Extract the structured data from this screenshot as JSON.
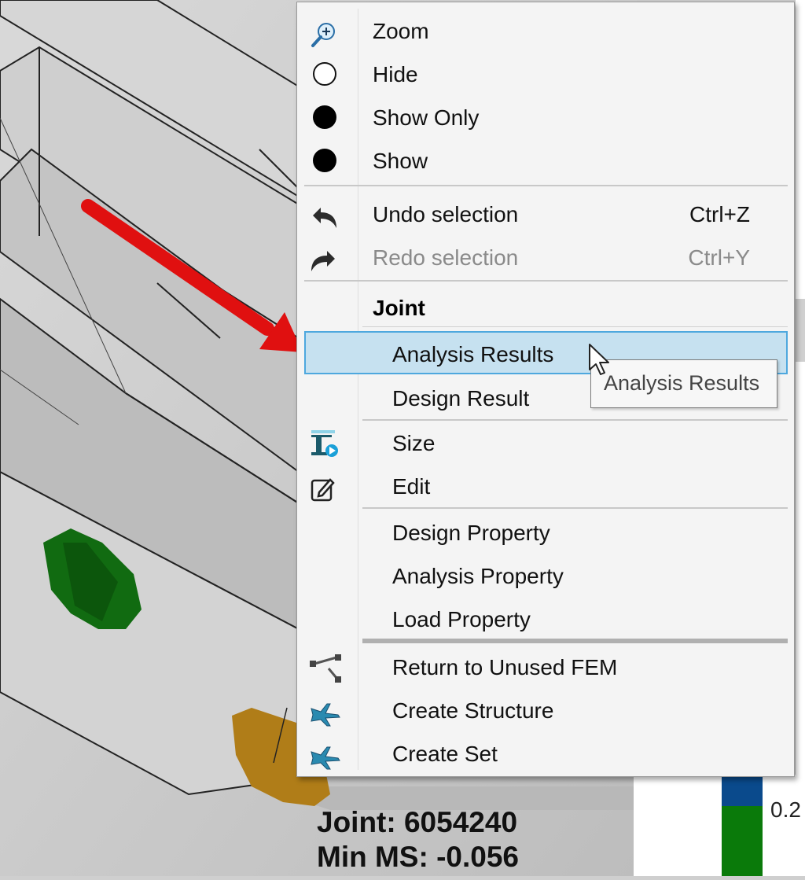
{
  "context_menu": {
    "zoom": "Zoom",
    "hide": "Hide",
    "show_only": "Show Only",
    "show": "Show",
    "undo": {
      "label": "Undo selection",
      "shortcut": "Ctrl+Z"
    },
    "redo": {
      "label": "Redo selection",
      "shortcut": "Ctrl+Y",
      "disabled": true
    },
    "section_header": "Joint",
    "analysis_results": "Analysis Results",
    "design_result": "Design Result",
    "size": "Size",
    "edit": "Edit",
    "design_property": "Design Property",
    "analysis_property": "Analysis Property",
    "load_property": "Load Property",
    "return_unused_fem": "Return to Unused FEM",
    "create_structure": "Create Structure",
    "create_set": "Create Set",
    "highlight_color": "#c6e1f0",
    "highlight_border": "#4ea8de"
  },
  "tooltip": "Analysis Results",
  "joint_info": {
    "joint": "Joint: 6054240",
    "min_ms": "Min MS: -0.056"
  },
  "legend": {
    "value": "0.2",
    "colors": [
      "#0a4a8c",
      "#0a7a0a"
    ]
  },
  "annotation_arrow_color": "#e01010",
  "icons": [
    "zoom-icon",
    "hide-icon",
    "show-only-icon",
    "show-icon",
    "undo-icon",
    "redo-icon",
    "size-icon",
    "edit-icon",
    "unused-fem-icon",
    "create-structure-icon",
    "create-set-icon"
  ]
}
